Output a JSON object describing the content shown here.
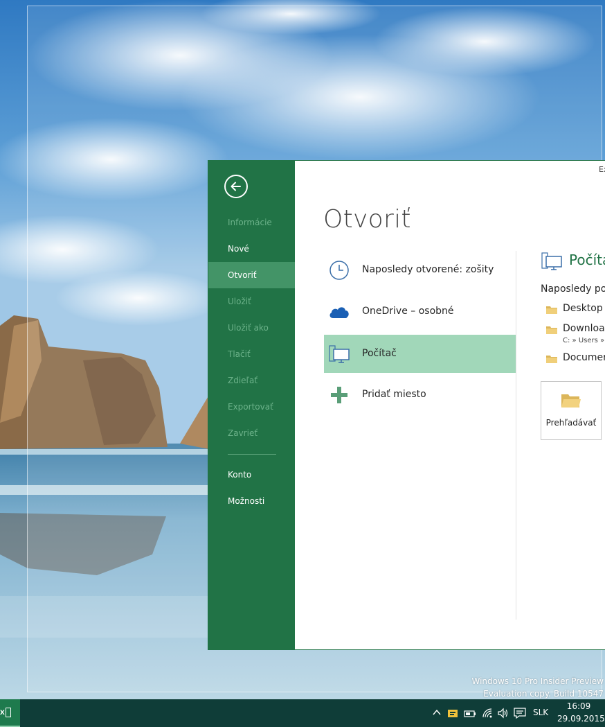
{
  "backstage": {
    "caption_fragment": "Ex",
    "nav": {
      "info": "Informácie",
      "new": "Nové",
      "open": "Otvoriť",
      "save": "Uložiť",
      "save_as": "Uložiť ako",
      "print": "Tlačiť",
      "share": "Zdieľať",
      "export": "Exportovať",
      "close": "Zavrieť",
      "account": "Konto",
      "options": "Možnosti"
    },
    "page_title": "Otvoriť",
    "places": {
      "recent": "Naposledy otvorené: zošity",
      "onedrive": "OneDrive – osobné",
      "computer": "Počítač",
      "add_place": "Pridať miesto"
    },
    "detail": {
      "title": "Počíta",
      "recent_folders_heading": "Naposledy po",
      "folders": [
        {
          "name": "Desktop",
          "path": ""
        },
        {
          "name": "Downloa",
          "path": "C: » Users »"
        },
        {
          "name": "Documer",
          "path": ""
        }
      ],
      "browse_label": "Prehľadávať"
    },
    "colors": {
      "accent": "#217346",
      "nav_active": "#439467",
      "selected_place": "#a1d7b9"
    }
  },
  "desktop": {
    "watermark_line1": "Windows 10 Pro Insider Preview",
    "watermark_line2": "Evaluation copy. Build 10547"
  },
  "taskbar": {
    "language": "SLK",
    "time": "16:09",
    "date": "29.09.2015"
  }
}
